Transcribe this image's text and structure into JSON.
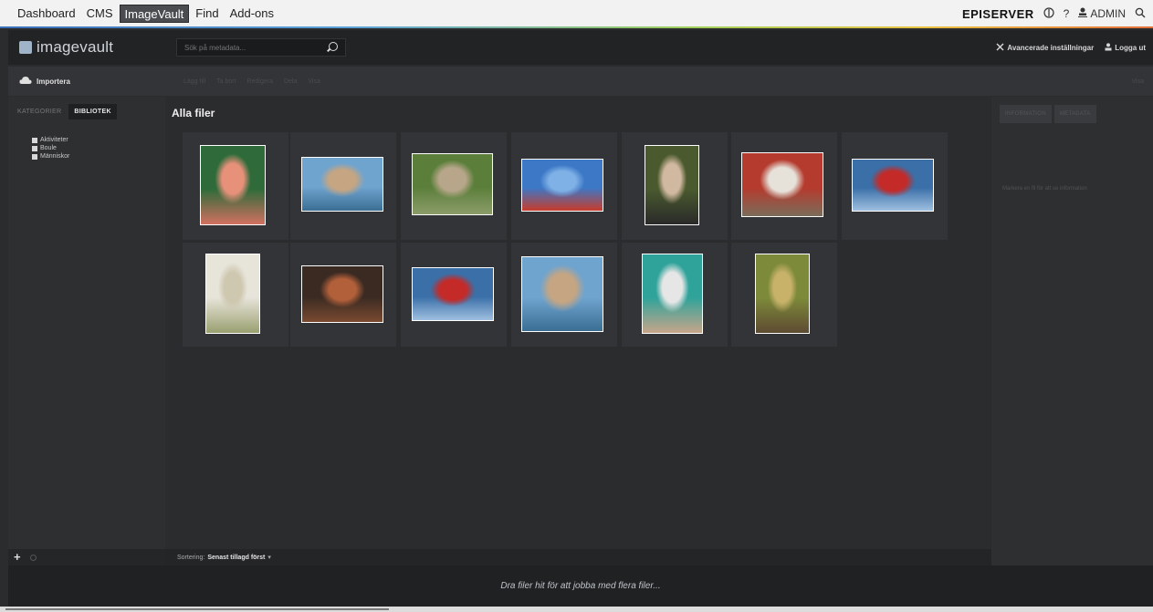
{
  "episerver": {
    "nav": [
      "Dashboard",
      "CMS",
      "ImageVault",
      "Find",
      "Add-ons"
    ],
    "active": "ImageVault",
    "brand": "EPISERVER",
    "help": "?",
    "user": "ADMIN"
  },
  "imagevault": {
    "logo": "imagevault",
    "search_placeholder": "Sök på metadata...",
    "advanced": "Avancerade inställningar",
    "logout": "Logga ut"
  },
  "toolbar": {
    "import": "Importera",
    "tools": [
      "Lägg till",
      "Ta bort",
      "Redigera",
      "Dela",
      "Visa"
    ],
    "right": "Visa"
  },
  "sidebar": {
    "tabs": [
      "KATEGORIER",
      "BIBLIOTEK"
    ],
    "active_tab": "BIBLIOTEK",
    "categories": [
      "Aktiviteter",
      "Boule",
      "Människor"
    ]
  },
  "main": {
    "title": "Alla filer",
    "sort_label": "Sortering:",
    "sort_value": "Senast tillagd först"
  },
  "right_panel": {
    "tabs": [
      "INFORMATION",
      "METADATA"
    ],
    "message": "Markera en fil för att se information"
  },
  "dropzone": {
    "text": "Dra filer hit för att jobba med flera filer..."
  },
  "thumbnails": [
    {
      "subject": "smiling elderly woman portrait",
      "colors": [
        "#2f6b3a",
        "#e8917a",
        "#d27060"
      ]
    },
    {
      "subject": "elderly couple with sky",
      "colors": [
        "#6fa4cf",
        "#c5a582",
        "#3b6e93"
      ]
    },
    {
      "subject": "couple walking in park",
      "colors": [
        "#5b7f3a",
        "#b8a68a",
        "#8c9c6a"
      ]
    },
    {
      "subject": "skydiver in blue sky",
      "colors": [
        "#3c78c6",
        "#7fb1e6",
        "#c83b2b"
      ]
    },
    {
      "subject": "laughing woman portrait",
      "colors": [
        "#4a5a2e",
        "#d1b8a0",
        "#2a2a2a"
      ]
    },
    {
      "subject": "man sitting outside red house",
      "colors": [
        "#b53b2e",
        "#e6e2da",
        "#7b6c5a"
      ]
    },
    {
      "subject": "couple in red jackets by sea",
      "colors": [
        "#3a6fa8",
        "#c42a28",
        "#9fc0e0"
      ]
    },
    {
      "subject": "woman with glass of wine",
      "colors": [
        "#e7e4da",
        "#cfc8b0",
        "#9aa070"
      ]
    },
    {
      "subject": "friends at dinner table",
      "colors": [
        "#3a2a22",
        "#b2603a",
        "#7a4a30"
      ]
    },
    {
      "subject": "couple in red jackets by sea",
      "colors": [
        "#3a6fa8",
        "#c42a28",
        "#9fc0e0"
      ]
    },
    {
      "subject": "elderly couple with sky",
      "colors": [
        "#6fa4cf",
        "#c5a582",
        "#3b6e93"
      ]
    },
    {
      "subject": "man in headband exercising",
      "colors": [
        "#2fa39a",
        "#e6e6e6",
        "#c7a58a"
      ]
    },
    {
      "subject": "man with basket of fruit",
      "colors": [
        "#7d8a3a",
        "#c8b26a",
        "#5e4b32"
      ]
    }
  ]
}
